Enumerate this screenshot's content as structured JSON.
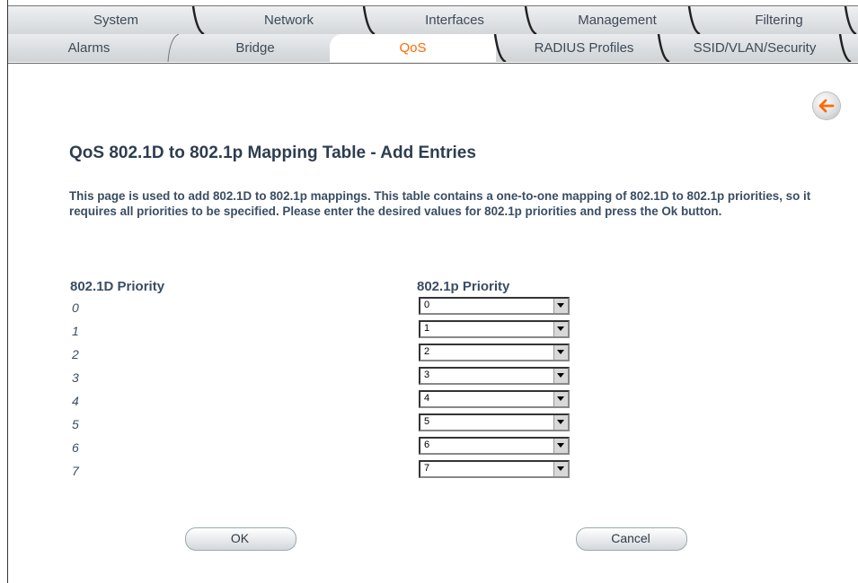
{
  "tabs_top": [
    "System",
    "Network",
    "Interfaces",
    "Management",
    "Filtering"
  ],
  "tabs_bottom": [
    "Alarms",
    "Bridge",
    "QoS",
    "RADIUS Profiles",
    "SSID/VLAN/Security"
  ],
  "active_tab": "QoS",
  "page": {
    "title": "QoS 802.1D to 802.1p Mapping Table - Add Entries",
    "description": "This page is used to add 802.1D to 802.1p mappings. This table contains a one-to-one mapping of 802.1D to 802.1p priorities, so it requires all priorities to be specified. Please enter the desired values for 802.1p priorities and press the Ok button.",
    "col_d": "802.1D Priority",
    "col_p": "802.1p Priority"
  },
  "rows": [
    {
      "d": "0",
      "p": "0"
    },
    {
      "d": "1",
      "p": "1"
    },
    {
      "d": "2",
      "p": "2"
    },
    {
      "d": "3",
      "p": "3"
    },
    {
      "d": "4",
      "p": "4"
    },
    {
      "d": "5",
      "p": "5"
    },
    {
      "d": "6",
      "p": "6"
    },
    {
      "d": "7",
      "p": "7"
    }
  ],
  "buttons": {
    "ok": "OK",
    "cancel": "Cancel"
  },
  "icons": {
    "back": "back-arrow-icon",
    "dropdown": "chevron-down-icon"
  },
  "colors": {
    "active_tab_text": "#ff6a00",
    "text": "#3a4d63"
  }
}
